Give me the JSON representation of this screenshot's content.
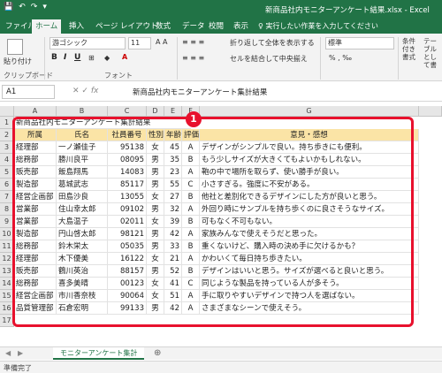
{
  "window": {
    "title": "新商品社内モニターアンケート結果.xlsx - Excel",
    "qat": [
      "💾",
      "↶",
      "↷",
      "▾"
    ]
  },
  "tabs": [
    "ファイル",
    "ホーム",
    "挿入",
    "ページ レイアウト",
    "数式",
    "データ",
    "校閲",
    "表示"
  ],
  "tellme": "♀ 実行したい作業を入力してください",
  "ribbon": {
    "paste_label": "貼り付け",
    "clipboard_group": "クリップボード",
    "font_name": "游ゴシック",
    "font_size": "11",
    "font_group": "フォント",
    "wrap_text": "折り返して全体を表示する",
    "merge_center": "セルを結合して中央揃え",
    "number_format": "標準",
    "cond_format": "条件付き書式",
    "table_format": "テーブルとして書式"
  },
  "formula_bar": {
    "name_box": "A1",
    "content": "新商品社内モニターアンケート集計結果"
  },
  "grid": {
    "columns": [
      "A",
      "B",
      "C",
      "D",
      "E",
      "F",
      "G"
    ],
    "title": "新商品社内モニターアンケート集計結果",
    "headers": [
      "所属",
      "氏名",
      "社員番号",
      "性別",
      "年齢",
      "評価",
      "意見・感想"
    ],
    "rows": [
      [
        "経理部",
        "一ノ瀬佳子",
        "95138",
        "女",
        "45",
        "A",
        "デザインがシンプルで良い。持ち歩きにも便利。"
      ],
      [
        "総務部",
        "勝川良平",
        "08095",
        "男",
        "35",
        "B",
        "もう少しサイズが大きくてもよいかもしれない。"
      ],
      [
        "販売部",
        "飯島翔馬",
        "14083",
        "男",
        "23",
        "A",
        "鞄の中で場所を取らず、使い勝手が良い。"
      ],
      [
        "製造部",
        "葛城武志",
        "85117",
        "男",
        "55",
        "C",
        "小さすぎる。強度に不安がある。"
      ],
      [
        "経営企画部",
        "田島沙良",
        "13055",
        "女",
        "27",
        "B",
        "他社と差別化できるデザインにした方が良いと思う。"
      ],
      [
        "営業部",
        "住山幸太郎",
        "09102",
        "男",
        "32",
        "A",
        "外回り時にサンプルを持ち歩くのに良さそうなサイズ。"
      ],
      [
        "営業部",
        "大島温子",
        "02011",
        "女",
        "39",
        "B",
        "可もなく不可もない。"
      ],
      [
        "製造部",
        "円山啓太郎",
        "98121",
        "男",
        "42",
        "A",
        "家族みんなで使えそうだと思った。"
      ],
      [
        "総務部",
        "鈴木栄太",
        "05035",
        "男",
        "33",
        "B",
        "重くないけど、購入時の決め手に欠けるかも？"
      ],
      [
        "経理部",
        "木下優美",
        "16122",
        "女",
        "21",
        "A",
        "かわいくて毎日持ち歩きたい。"
      ],
      [
        "販売部",
        "鶴川英治",
        "88157",
        "男",
        "52",
        "B",
        "デザインはいいと思う。サイズが選べると良いと思う。"
      ],
      [
        "総務部",
        "喜多美晴",
        "00123",
        "女",
        "41",
        "C",
        "同じような製品を持っている人が多そう。"
      ],
      [
        "経営企画部",
        "市川香奈枝",
        "90064",
        "女",
        "51",
        "A",
        "手に取りやすいデザインで持つ人を選ばない。"
      ],
      [
        "品質管理部",
        "石倉宏明",
        "99133",
        "男",
        "42",
        "A",
        "さまざまなシーンで使えそう。"
      ]
    ]
  },
  "annotation": {
    "badge": "1"
  },
  "sheet": {
    "tab": "モニターアンケート集計",
    "add": "⊕"
  },
  "status": "準備完了"
}
